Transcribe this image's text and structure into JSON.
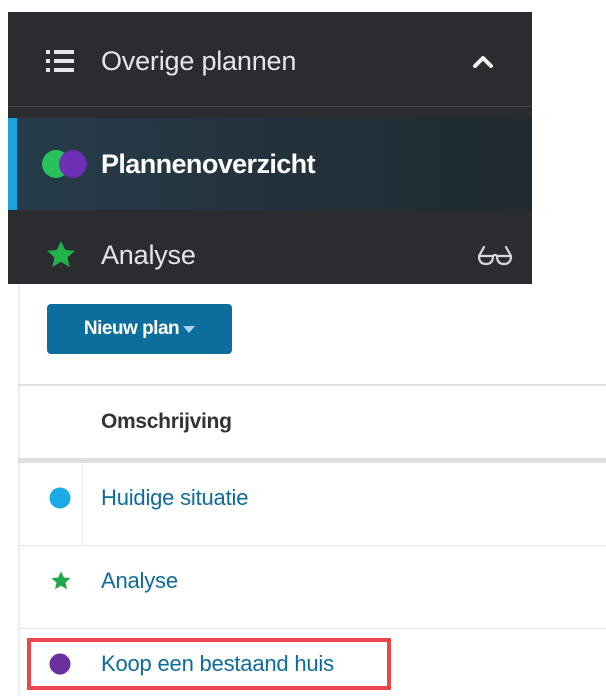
{
  "nav": {
    "header_label": "Overige plannen",
    "items": [
      {
        "label": "Plannenoverzicht",
        "active": true
      },
      {
        "label": "Analyse",
        "active": false
      }
    ]
  },
  "toolbar": {
    "new_plan_label": "Nieuw plan"
  },
  "table": {
    "header": "Omschrijving",
    "rows": [
      {
        "label": "Huidige situatie",
        "icon": "circle-icon",
        "color": "#1ba9e8"
      },
      {
        "label": "Analyse",
        "icon": "star-icon",
        "color": "#20a84b"
      },
      {
        "label": "Koop een bestaand huis",
        "icon": "circle-icon",
        "color": "#6b2fa0",
        "highlighted": true
      }
    ]
  },
  "colors": {
    "nav_bg": "#2a2c2f",
    "active_accent": "#1ca4dc",
    "primary_button": "#0c6e9c",
    "link_text": "#0e6c9b",
    "highlight_border": "#e9474c",
    "plan_icon_green": "#28c15b",
    "plan_icon_purple": "#6d2fb3"
  }
}
